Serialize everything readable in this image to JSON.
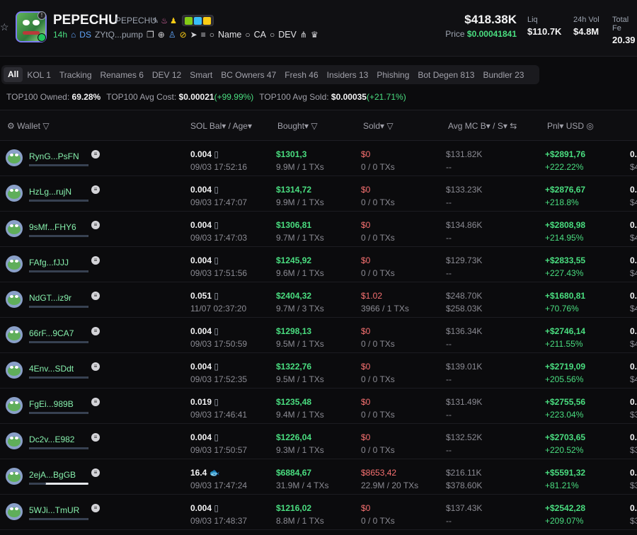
{
  "token": {
    "name": "PEPECHU",
    "symbol": "PEPECHU",
    "age": "14h",
    "ds_label": "DS",
    "address": "ZYtQ...pump",
    "links": [
      "Name",
      "CA",
      "DEV"
    ]
  },
  "market": {
    "mcap": "$418.38K",
    "price_label": "Price",
    "price": "$0.00041841",
    "liq_label": "Liq",
    "liq": "$110.7K",
    "vol_label": "24h Vol",
    "vol": "$4.8M",
    "total_label": "Total Fe",
    "total": "20.39"
  },
  "tabs": [
    "All",
    "KOL 1",
    "Tracking",
    "Renames 6",
    "DEV 12",
    "Smart",
    "BC Owners 47",
    "Fresh 46",
    "Insiders 13",
    "Phishing",
    "Bot Degen 813",
    "Bundler 23"
  ],
  "summary": {
    "owned_label": "TOP100 Owned:",
    "owned": "69.28%",
    "avgcost_label": "TOP100 Avg Cost:",
    "avgcost": "$0.00021",
    "avgcost_chg": "(+99.99%)",
    "avgsold_label": "TOP100 Avg Sold:",
    "avgsold": "$0.00035",
    "avgsold_chg": "(+21.71%)"
  },
  "columns": {
    "wallet": "Wallet",
    "solbal": "SOL Bal",
    "age": "/ Age",
    "bought": "Bought",
    "sold": "Sold",
    "avgmc": "Avg MC B",
    "avgmc_s": "/ S",
    "pnl": "Pnl",
    "usd": "USD"
  },
  "rows": [
    {
      "wallet": "RynG...PsFN",
      "sol": "0.004",
      "time": "09/03 17:52:16",
      "bought": "$1301,3",
      "bought_sub": "9.9M / 1 TXs",
      "sold": "$0",
      "sold_sub": "0 / 0 TXs",
      "mcb": "$131.82K",
      "mcs": "--",
      "pnl": "+$2891,76",
      "pnl_pct": "+222.22%",
      "extra": "0.",
      "extra2": "$4",
      "bar": 1.0
    },
    {
      "wallet": "HzLg...rujN",
      "sol": "0.004",
      "time": "09/03 17:47:07",
      "bought": "$1314,72",
      "bought_sub": "9.9M / 1 TXs",
      "sold": "$0",
      "sold_sub": "0 / 0 TXs",
      "mcb": "$133.23K",
      "mcs": "--",
      "pnl": "+$2876,67",
      "pnl_pct": "+218.8%",
      "extra": "0.",
      "extra2": "$4",
      "bar": 1.0
    },
    {
      "wallet": "9sMf...FHY6",
      "sol": "0.004",
      "time": "09/03 17:47:03",
      "bought": "$1306,81",
      "bought_sub": "9.7M / 1 TXs",
      "sold": "$0",
      "sold_sub": "0 / 0 TXs",
      "mcb": "$134.86K",
      "mcs": "--",
      "pnl": "+$2808,98",
      "pnl_pct": "+214.95%",
      "extra": "0.",
      "extra2": "$4",
      "bar": 1.0
    },
    {
      "wallet": "FAfg...fJJJ",
      "sol": "0.004",
      "time": "09/03 17:51:56",
      "bought": "$1245,92",
      "bought_sub": "9.6M / 1 TXs",
      "sold": "$0",
      "sold_sub": "0 / 0 TXs",
      "mcb": "$129.73K",
      "mcs": "--",
      "pnl": "+$2833,55",
      "pnl_pct": "+227.43%",
      "extra": "0.",
      "extra2": "$4",
      "bar": 1.0
    },
    {
      "wallet": "NdGT...iz9r",
      "sol": "0.051",
      "time": "11/07 02:37:20",
      "bought": "$2404,32",
      "bought_sub": "9.7M / 3 TXs",
      "sold": "$1.02",
      "sold_sub": "3966 / 1 TXs",
      "mcb": "$248.70K",
      "mcs": "$258.03K",
      "pnl": "+$1680,81",
      "pnl_pct": "+70.76%",
      "extra": "0.",
      "extra2": "$4",
      "bar": 1.0
    },
    {
      "wallet": "66rF...9CA7",
      "sol": "0.004",
      "time": "09/03 17:50:59",
      "bought": "$1298,13",
      "bought_sub": "9.5M / 1 TXs",
      "sold": "$0",
      "sold_sub": "0 / 0 TXs",
      "mcb": "$136.34K",
      "mcs": "--",
      "pnl": "+$2746,14",
      "pnl_pct": "+211.55%",
      "extra": "0.",
      "extra2": "$4",
      "bar": 1.0
    },
    {
      "wallet": "4Env...SDdt",
      "sol": "0.004",
      "time": "09/03 17:52:35",
      "bought": "$1322,76",
      "bought_sub": "9.5M / 1 TXs",
      "sold": "$0",
      "sold_sub": "0 / 0 TXs",
      "mcb": "$139.01K",
      "mcs": "--",
      "pnl": "+$2719,09",
      "pnl_pct": "+205.56%",
      "extra": "0.",
      "extra2": "$4",
      "bar": 1.0
    },
    {
      "wallet": "FgEi...989B",
      "sol": "0.019",
      "time": "09/03 17:46:41",
      "bought": "$1235,48",
      "bought_sub": "9.4M / 1 TXs",
      "sold": "$0",
      "sold_sub": "0 / 0 TXs",
      "mcb": "$131.49K",
      "mcs": "--",
      "pnl": "+$2755,56",
      "pnl_pct": "+223.04%",
      "extra": "0.",
      "extra2": "$3",
      "bar": 1.0
    },
    {
      "wallet": "Dc2v...E982",
      "sol": "0.004",
      "time": "09/03 17:50:57",
      "bought": "$1226,04",
      "bought_sub": "9.3M / 1 TXs",
      "sold": "$0",
      "sold_sub": "0 / 0 TXs",
      "mcb": "$132.52K",
      "mcs": "--",
      "pnl": "+$2703,65",
      "pnl_pct": "+220.52%",
      "extra": "0.",
      "extra2": "$3",
      "bar": 1.0
    },
    {
      "wallet": "2ejA...BgGB",
      "sol": "16.4",
      "time": "09/03 17:47:24",
      "bought": "$6884,67",
      "bought_sub": "31.9M / 4 TXs",
      "sold": "$8653,42",
      "sold_sub": "22.9M / 20 TXs",
      "mcb": "$216.11K",
      "mcs": "$378.60K",
      "pnl": "+$5591,32",
      "pnl_pct": "+81.21%",
      "extra": "0.",
      "extra2": "$3",
      "bar": 0.28
    },
    {
      "wallet": "5WJi...TmUR",
      "sol": "0.004",
      "time": "09/03 17:48:37",
      "bought": "$1216,02",
      "bought_sub": "8.8M / 1 TXs",
      "sold": "$0",
      "sold_sub": "0 / 0 TXs",
      "mcb": "$137.43K",
      "mcs": "--",
      "pnl": "+$2542,28",
      "pnl_pct": "+209.07%",
      "extra": "0.",
      "extra2": "$3",
      "bar": 1.0
    }
  ]
}
